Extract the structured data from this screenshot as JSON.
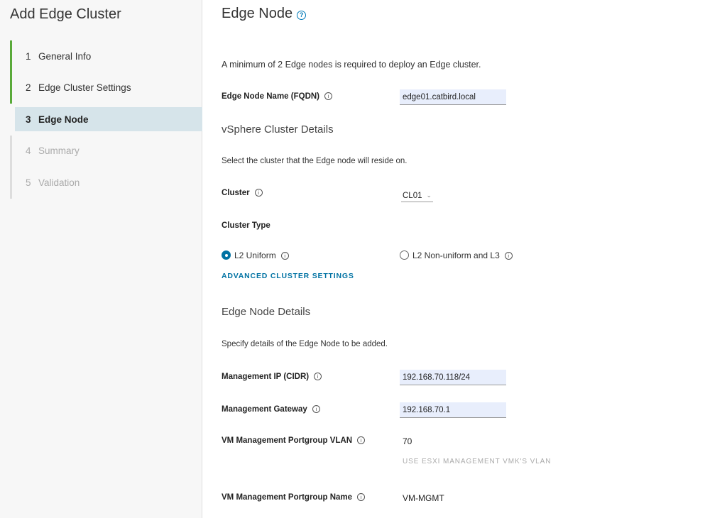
{
  "wizard": {
    "title": "Add Edge Cluster",
    "steps": [
      {
        "num": "1",
        "label": "General Info"
      },
      {
        "num": "2",
        "label": "Edge Cluster Settings"
      },
      {
        "num": "3",
        "label": "Edge Node"
      },
      {
        "num": "4",
        "label": "Summary"
      },
      {
        "num": "5",
        "label": "Validation"
      }
    ]
  },
  "page": {
    "title": "Edge Node",
    "intro": "A minimum of 2 Edge nodes is required to deploy an Edge cluster."
  },
  "edge_node_name": {
    "label": "Edge Node Name (FQDN)",
    "value": "edge01.catbird.local"
  },
  "vsphere": {
    "heading": "vSphere Cluster Details",
    "description": "Select the cluster that the Edge node will reside on.",
    "cluster_label": "Cluster",
    "cluster_value": "CL01",
    "cluster_type_label": "Cluster Type",
    "option_uniform": "L2 Uniform",
    "option_nonuniform": "L2 Non-uniform and L3",
    "advanced_link": "ADVANCED CLUSTER SETTINGS"
  },
  "details": {
    "heading": "Edge Node Details",
    "description": "Specify details of the Edge Node to be added.",
    "mgmt_ip_label": "Management IP (CIDR)",
    "mgmt_ip_value": "192.168.70.118/24",
    "mgmt_gw_label": "Management Gateway",
    "mgmt_gw_value": "192.168.70.1",
    "vlan_label": "VM Management Portgroup VLAN",
    "vlan_value": "70",
    "vlan_hint": "USE ESXI MANAGEMENT VMK'S VLAN",
    "pg_name_label": "VM Management Portgroup Name",
    "pg_name_value": "VM-MGMT"
  },
  "icons": {
    "help": "help-circle-icon",
    "info": "info-circle-icon",
    "dropdown": "chevron-down-icon"
  },
  "colors": {
    "accent": "#0072a3",
    "completed_step": "#5aaa3a",
    "active_step_bg": "#d6e4ea",
    "input_bg": "#e8eefc"
  }
}
